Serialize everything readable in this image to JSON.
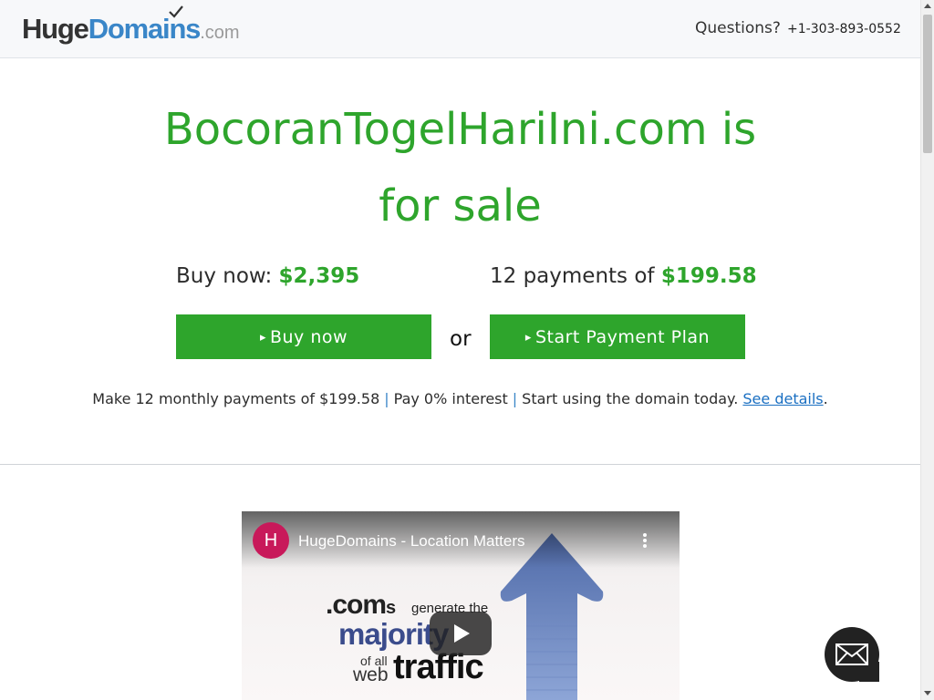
{
  "header": {
    "logo": {
      "huge": "Huge",
      "domains": "Domains",
      "dotcom": ".com"
    },
    "questions_label": "Questions?",
    "phone": "+1-303-893-0552"
  },
  "main": {
    "title": "BocoranTogelHariIni.com is for sale",
    "buy_now_label": "Buy now:",
    "buy_now_price": "$2,395",
    "payments_label": "12 payments of",
    "payments_price": "$199.58",
    "buy_button_label": "Buy now",
    "or_label": "or",
    "plan_button_label": "Start Payment Plan",
    "details": {
      "part1": "Make 12 monthly payments of $199.58",
      "part2": "Pay 0% interest",
      "part3": "Start using the domain today.",
      "link": "See details",
      "end": ".",
      "separator": "|"
    }
  },
  "video": {
    "channel_initial": "H",
    "title": "HugeDomains - Location Matters",
    "thumbnail_text": {
      "coms": ".com",
      "coms_s": "s",
      "generate": "generate the",
      "majority": "majority",
      "of_all": "of all",
      "web": "web",
      "traffic": "traffic"
    }
  },
  "icons": {
    "play": "play-icon",
    "menu": "more-vertical-icon",
    "chat": "envelope-icon",
    "button_arrow": "▸"
  },
  "colors": {
    "accent_green": "#2ea52c",
    "brand_blue": "#3a86c8",
    "link_blue": "#1a6fc2",
    "channel_avatar": "#c8195a"
  }
}
